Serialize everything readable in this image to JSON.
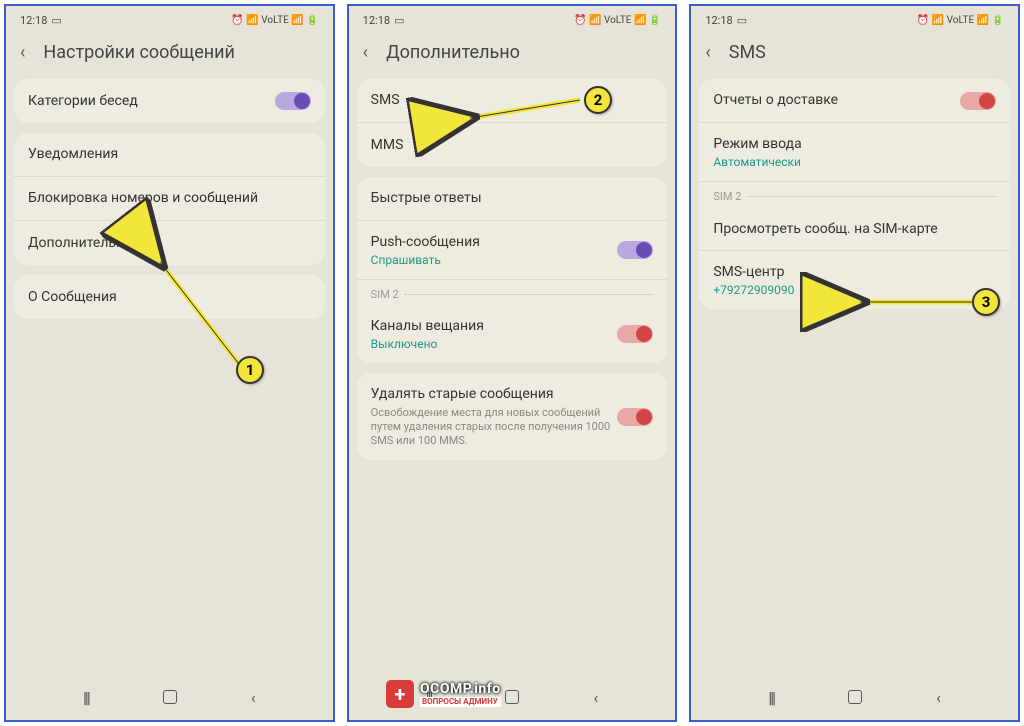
{
  "status": {
    "time": "12:18",
    "icons": "⏰ 📶 VoLTE 📶 🔋"
  },
  "screen1": {
    "title": "Настройки сообщений",
    "items": {
      "categories": "Категории бесед",
      "notifications": "Уведомления",
      "block": "Блокировка номеров и сообщений",
      "advanced": "Дополнительно",
      "about": "О Сообщения"
    }
  },
  "screen2": {
    "title": "Дополнительно",
    "items": {
      "sms": "SMS",
      "mms": "MMS",
      "quick": "Быстрые ответы",
      "push": "Push-сообщения",
      "push_sub": "Спрашивать",
      "sim2": "SIM 2",
      "broadcast": "Каналы вещания",
      "broadcast_sub": "Выключено",
      "delete_old": "Удалять старые сообщения",
      "delete_desc": "Освобождение места для новых сообщений путем удаления старых после получения 1000 SMS или 100 MMS."
    }
  },
  "screen3": {
    "title": "SMS",
    "items": {
      "delivery": "Отчеты о доставке",
      "input_mode": "Режим ввода",
      "input_mode_sub": "Автоматически",
      "sim2": "SIM 2",
      "view_sim": "Просмотреть сообщ. на SIM-карте",
      "sms_center": "SMS-центр",
      "sms_center_sub": "+79272909090"
    }
  },
  "callouts": {
    "c1": "1",
    "c2": "2",
    "c3": "3"
  },
  "logo": {
    "main": "OCOMP.info",
    "sub": "ВОПРОСЫ АДМИНУ"
  }
}
